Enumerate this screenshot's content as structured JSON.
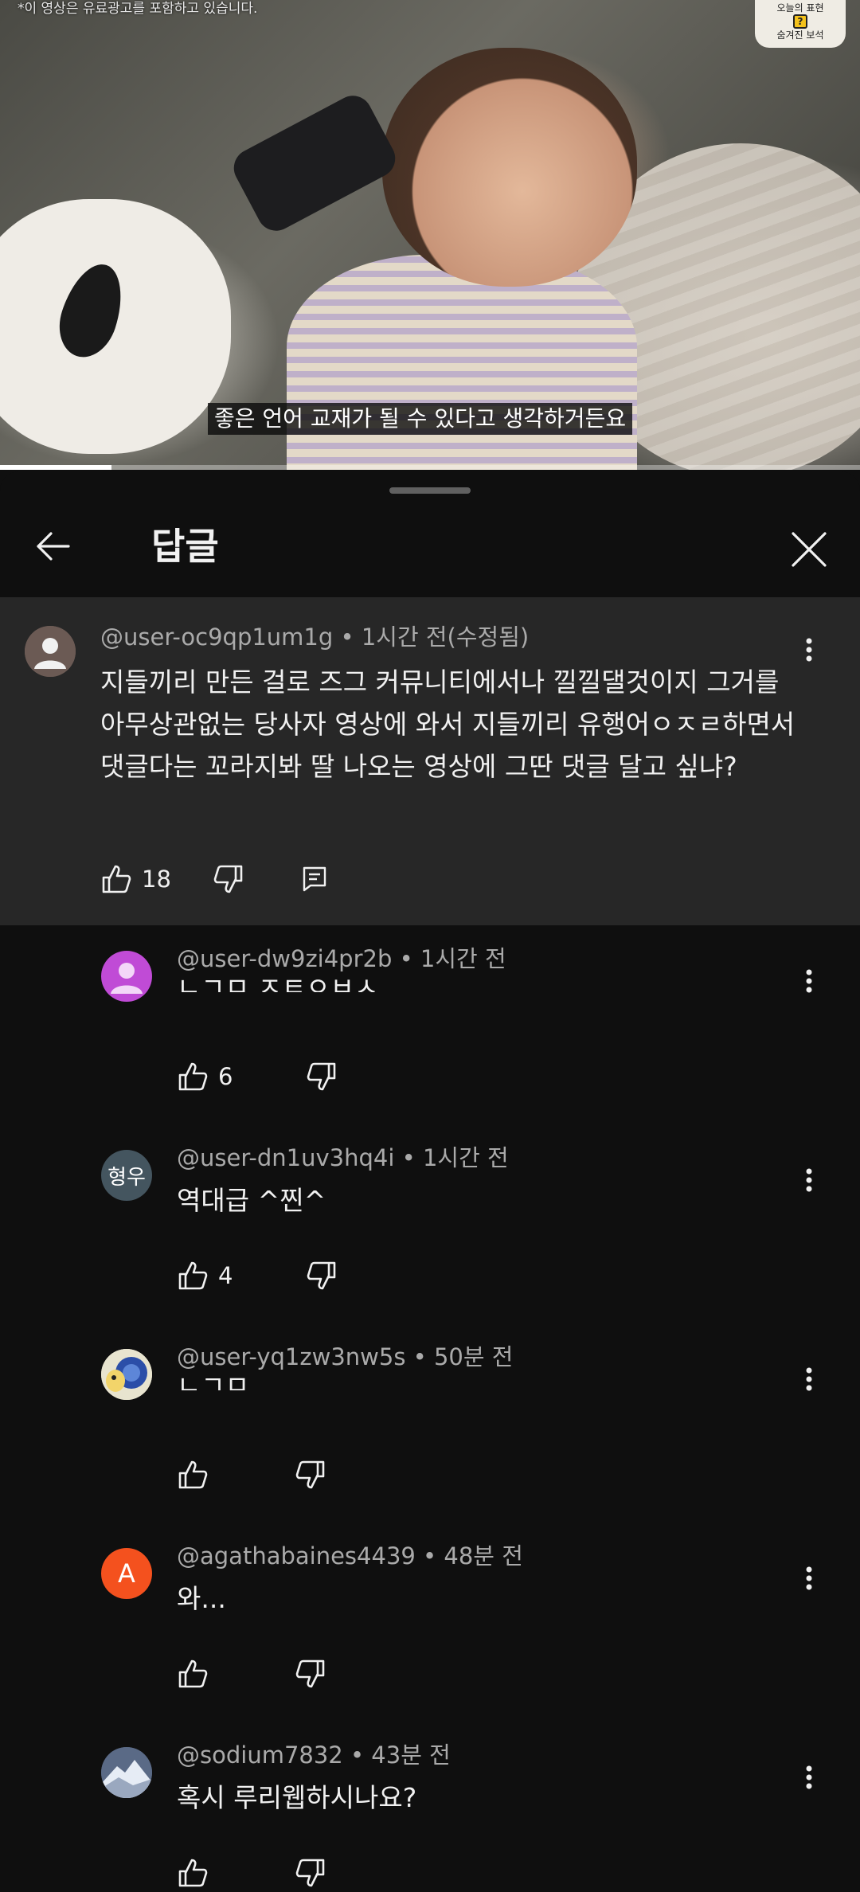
{
  "video": {
    "ad_notice": "*이 영상은 유료광고를 포함하고 있습니다.",
    "badge_line1": "오늘의 표현",
    "badge_icon": "?",
    "badge_line2": "숨겨진 보석",
    "subtitle": "좋은 언어 교재가 될 수 있다고 생각하거든요",
    "progress": 0.13
  },
  "header": {
    "title": "답글",
    "back_icon": "arrow-left-icon",
    "close_icon": "close-icon"
  },
  "parent_comment": {
    "author": "@user-oc9qp1um1g",
    "time": "1시간 전(수정됨)",
    "text": "지들끼리 만든 걸로 즈그 커뮤니티에서나 낄낄댈것이지 그거를 아무상관없는 당사자 영상에 와서 지들끼리 유행어ㅇㅈㄹ하면서 댓글다는 꼬라지봐 딸 나오는 영상에 그딴 댓글 달고 싶냐?",
    "likes": "18"
  },
  "replies": [
    {
      "author": "@user-dw9zi4pr2b",
      "time": "1시간 전",
      "text": "ㄴㄱㅁ ㅈㅌㅇㅂㅅ",
      "likes": "6",
      "avatar_color": "#c04bd6",
      "avatar_text": ""
    },
    {
      "author": "@user-dn1uv3hq4i",
      "time": "1시간 전",
      "text": "역대급 ^찐^",
      "likes": "4",
      "avatar_color": "#44555f",
      "avatar_text": "형우"
    },
    {
      "author": "@user-yq1zw3nw5s",
      "time": "50분 전",
      "text": "ㄴㄱㅁ",
      "likes": "",
      "avatar_color": "#e8e4cf",
      "avatar_text": ""
    },
    {
      "author": "@agathabaines4439",
      "time": "48분 전",
      "text": "와...",
      "likes": "",
      "avatar_color": "#f4511e",
      "avatar_text": "A"
    },
    {
      "author": "@sodium7832",
      "time": "43분 전",
      "text": "혹시 루리웹하시나요?",
      "likes": "",
      "avatar_color": "#3f4a5f",
      "avatar_text": ""
    }
  ],
  "separator": " • "
}
